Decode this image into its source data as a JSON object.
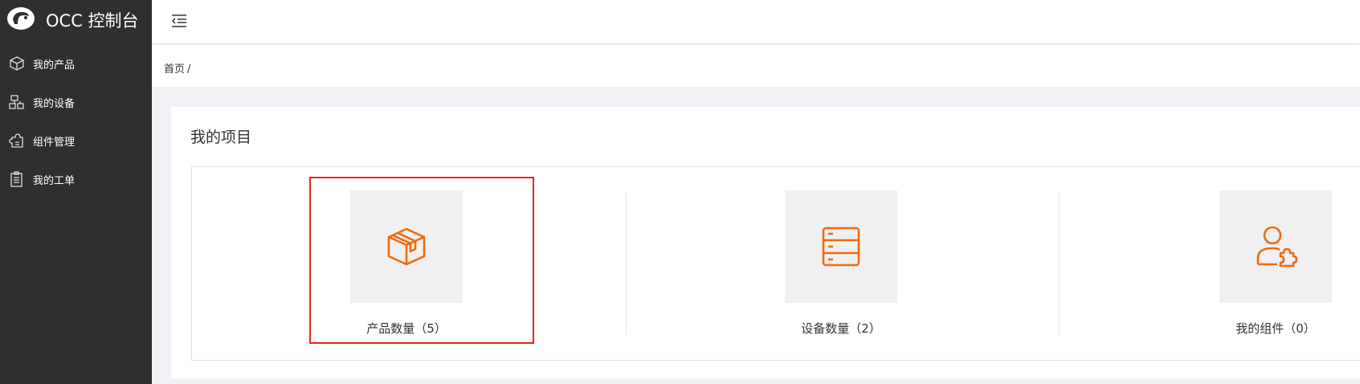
{
  "app": {
    "title": "OCC 控制台",
    "logo_icon": "logo-icon"
  },
  "sidebar": {
    "items": [
      {
        "label": "我的产品",
        "icon": "cube-icon"
      },
      {
        "label": "我的设备",
        "icon": "devices-icon"
      },
      {
        "label": "组件管理",
        "icon": "puzzle-icon"
      },
      {
        "label": "我的工单",
        "icon": "clipboard-icon"
      }
    ]
  },
  "topbar": {
    "menu_icon": "menu-collapse-icon"
  },
  "breadcrumb": {
    "home": "首页",
    "separator": "/"
  },
  "projects": {
    "title": "我的项目",
    "cards": [
      {
        "label": "产品数量（5）",
        "icon": "box-icon"
      },
      {
        "label": "设备数量（2）",
        "icon": "server-icon"
      },
      {
        "label": "我的组件（0）",
        "icon": "user-puzzle-icon"
      }
    ]
  },
  "colors": {
    "sidebar_bg": "#2f2f2f",
    "accent": "#f06a0f",
    "highlight": "#e8261c",
    "page_bg": "#f0f2f5",
    "tile_bg": "#f0f0f0"
  }
}
